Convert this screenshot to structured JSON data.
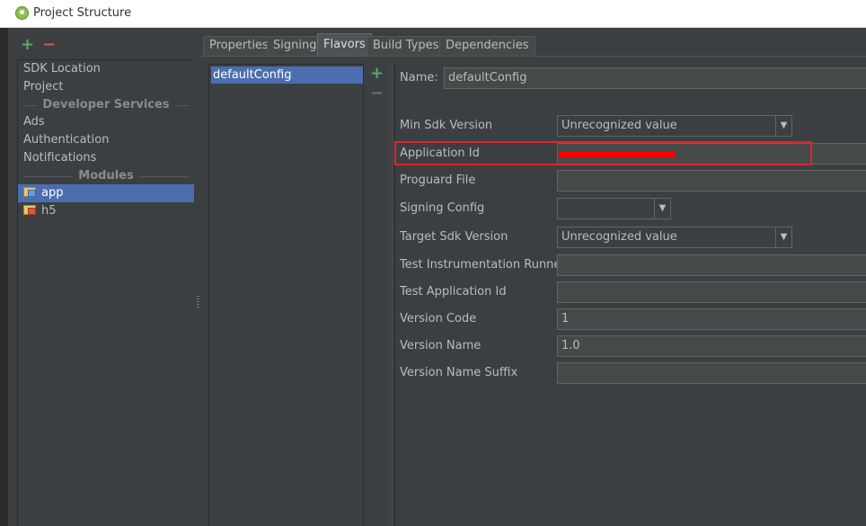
{
  "window": {
    "title": "Project Structure",
    "icon": "android-studio-icon"
  },
  "left_toolbar": {
    "add_icon": "plus-icon",
    "remove_icon": "minus-icon"
  },
  "sidebar": {
    "items": [
      {
        "label": "SDK Location"
      },
      {
        "label": "Project"
      }
    ],
    "developer_services": {
      "heading": "Developer Services",
      "items": [
        {
          "label": "Ads"
        },
        {
          "label": "Authentication"
        },
        {
          "label": "Notifications"
        }
      ]
    },
    "modules": {
      "heading": "Modules",
      "items": [
        {
          "label": "app",
          "icon": "module-icon",
          "selected": true
        },
        {
          "label": "h5",
          "icon": "module-icon",
          "selected": false
        }
      ]
    }
  },
  "tabs": [
    {
      "label": "Properties",
      "active": false
    },
    {
      "label": "Signing",
      "active": false
    },
    {
      "label": "Flavors",
      "active": true
    },
    {
      "label": "Build Types",
      "active": false
    },
    {
      "label": "Dependencies",
      "active": false
    }
  ],
  "flavors": {
    "items": [
      {
        "label": "defaultConfig",
        "selected": true
      }
    ],
    "add_icon": "plus-icon",
    "remove_icon": "minus-icon"
  },
  "form": {
    "name": {
      "label": "Name:",
      "value": "defaultConfig"
    },
    "min_sdk": {
      "label": "Min Sdk Version",
      "value": "Unrecognized value"
    },
    "application_id": {
      "label": "Application Id",
      "value": ""
    },
    "proguard_file": {
      "label": "Proguard File",
      "value": ""
    },
    "signing_config": {
      "label": "Signing Config",
      "value": ""
    },
    "target_sdk": {
      "label": "Target Sdk Version",
      "value": "Unrecognized value"
    },
    "test_runner": {
      "label": "Test Instrumentation Runner",
      "value": ""
    },
    "test_app_id": {
      "label": "Test Application Id",
      "value": ""
    },
    "version_code": {
      "label": "Version Code",
      "value": "1"
    },
    "version_name": {
      "label": "Version Name",
      "value": "1.0"
    },
    "version_name_suffix": {
      "label": "Version Name Suffix",
      "value": ""
    }
  },
  "colors": {
    "background": "#3c3f41",
    "selection": "#4b6eaf",
    "add_green": "#59a869",
    "remove_red": "#d9534f",
    "highlight_red": "#e0232d"
  }
}
